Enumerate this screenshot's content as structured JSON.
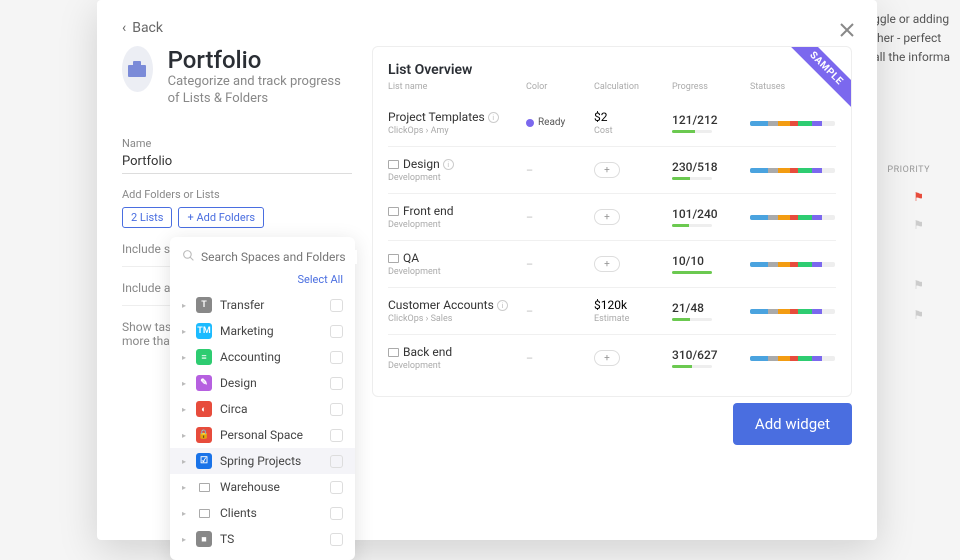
{
  "back_label": "Back",
  "title": "Portfolio",
  "subtitle": "Categorize and track progress of Lists & Folders",
  "name_label": "Name",
  "name_value": "Portfolio",
  "add_label": "Add Folders or Lists",
  "chip_lists": "2 Lists",
  "chip_folders": "+ Add Folders",
  "include_subtasks": "Include su",
  "include_archived": "Include ar",
  "show_tasks": "Show task",
  "more_than": "more than",
  "search_placeholder": "Search Spaces and Folders",
  "select_all": "Select All",
  "spaces": [
    {
      "label": "Transfer",
      "color": "#888",
      "letter": "T"
    },
    {
      "label": "Marketing",
      "color": "#1cbbff",
      "letter": "TM"
    },
    {
      "label": "Accounting",
      "color": "#2ecc71",
      "letter": "≡"
    },
    {
      "label": "Design",
      "color": "#b660e0",
      "letter": "✎"
    },
    {
      "label": "Circa",
      "color": "#e74c3c",
      "letter": "◐"
    },
    {
      "label": "Personal Space",
      "color": "#e74c3c",
      "letter": "🔒",
      "lock": true
    },
    {
      "label": "Spring Projects",
      "color": "#1a73e8",
      "letter": "☑",
      "hover": true
    },
    {
      "label": "Warehouse",
      "color": "#888",
      "letter": "",
      "folder": true
    },
    {
      "label": "Clients",
      "color": "#888",
      "letter": "",
      "folder": true
    },
    {
      "label": "TS",
      "color": "#888",
      "letter": "■"
    }
  ],
  "preview_title": "List Overview",
  "ribbon": "SAMPLE",
  "cols": {
    "c1": "List name",
    "c2": "Color",
    "c3": "Calculation",
    "c4": "Progress",
    "c5": "Statuses"
  },
  "rows": [
    {
      "name": "Project Templates",
      "sub": "ClickOps  ›  Amy",
      "info": true,
      "color_label": "Ready",
      "color_dot": true,
      "calc": "$2",
      "calc_sub": "Cost",
      "prog": "121/212",
      "pct": 57
    },
    {
      "name": "Design",
      "sub": "Development",
      "folder": true,
      "info": true,
      "calc": "",
      "plus": true,
      "prog": "230/518",
      "pct": 44
    },
    {
      "name": "Front end",
      "sub": "Development",
      "folder": true,
      "calc": "",
      "plus": true,
      "prog": "101/240",
      "pct": 42
    },
    {
      "name": "QA",
      "sub": "Development",
      "folder": true,
      "calc": "",
      "plus": true,
      "prog": "10/10",
      "pct": 100
    },
    {
      "name": "Customer Accounts",
      "sub": "ClickOps  ›  Sales",
      "info": true,
      "calc": "$120k",
      "calc_sub": "Estimate",
      "prog": "21/48",
      "pct": 44
    },
    {
      "name": "Back end",
      "sub": "Development",
      "folder": true,
      "calc": "",
      "plus": true,
      "prog": "310/627",
      "pct": 49
    }
  ],
  "add_widget": "Add widget",
  "priority_label": "PRIORITY",
  "bg_text1": "ggle or adding",
  "bg_text2": "ther - perfect",
  "bg_text3": "all the informa"
}
